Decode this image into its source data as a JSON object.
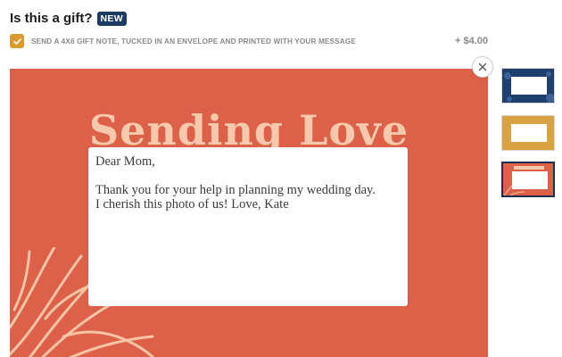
{
  "gift": {
    "title": "Is this a gift?",
    "badge": "NEW",
    "option_label": "SEND A 4X6 GIFT NOTE, TUCKED IN AN ENVELOPE AND PRINTED WITH YOUR MESSAGE",
    "option_checked": true,
    "price": "+ $4.00"
  },
  "card": {
    "heading": "Sending Love",
    "background_color": "#dd6049",
    "message": "Dear Mom,\n\nThank you for your help in planning my wedding day.\nI cherish this photo of us! Love, Kate"
  },
  "thumbnails": [
    {
      "color": "#1f3f6e",
      "selected": false
    },
    {
      "color": "#d9a343",
      "selected": false
    },
    {
      "color": "#dd6049",
      "selected": true
    }
  ],
  "icons": {
    "checkbox": "check-icon",
    "close": "close-icon"
  },
  "colors": {
    "accent_checkbox": "#d79b2e",
    "badge": "#1d3b63",
    "card_heading": "#f6c9ac"
  }
}
